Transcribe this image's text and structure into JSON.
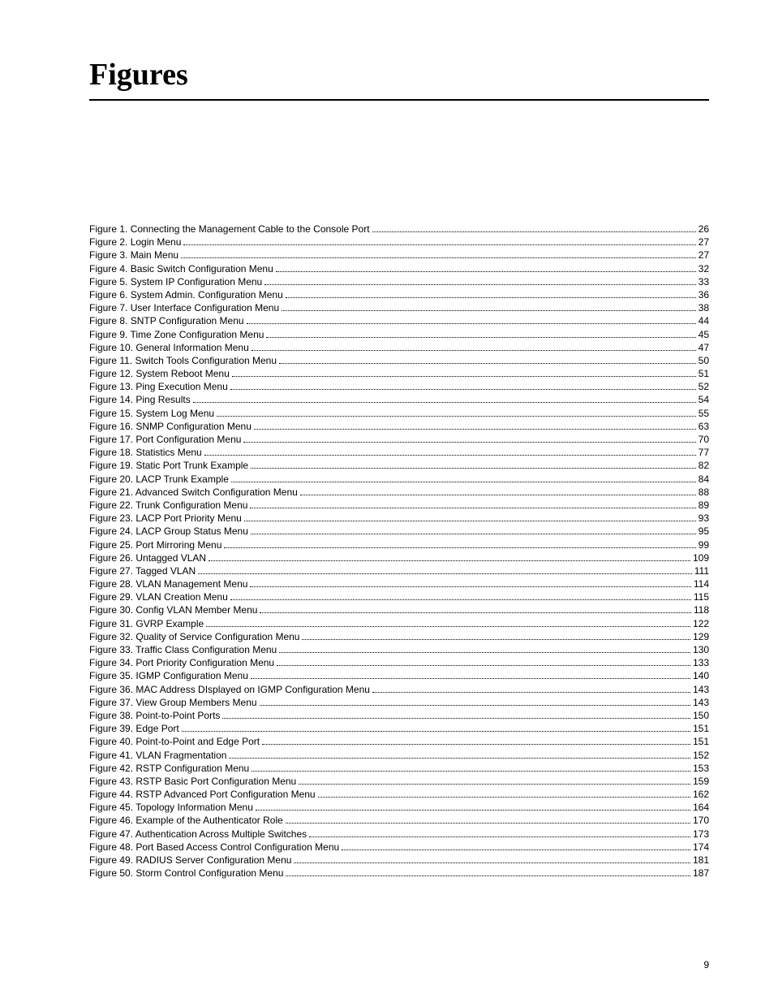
{
  "title": "Figures",
  "page_number": "9",
  "entries": [
    {
      "num": "1",
      "title": "Connecting the Management Cable to the Console Port",
      "page": "26"
    },
    {
      "num": "2",
      "title": "Login Menu",
      "page": "27"
    },
    {
      "num": "3",
      "title": "Main Menu",
      "page": "27"
    },
    {
      "num": "4",
      "title": "Basic Switch Configuration Menu",
      "page": "32"
    },
    {
      "num": "5",
      "title": "System IP Configuration Menu",
      "page": "33"
    },
    {
      "num": "6",
      "title": "System Admin. Configuration Menu",
      "page": "36"
    },
    {
      "num": "7",
      "title": "User Interface Configuration Menu",
      "page": "38"
    },
    {
      "num": "8",
      "title": "SNTP Configuration Menu",
      "page": "44"
    },
    {
      "num": "9",
      "title": "Time Zone Configuration Menu",
      "page": "45"
    },
    {
      "num": "10",
      "title": "General Information Menu",
      "page": "47"
    },
    {
      "num": "11",
      "title": "Switch Tools Configuration Menu",
      "page": "50"
    },
    {
      "num": "12",
      "title": "System Reboot Menu",
      "page": "51"
    },
    {
      "num": "13",
      "title": "Ping Execution Menu",
      "page": "52"
    },
    {
      "num": "14",
      "title": "Ping Results",
      "page": "54"
    },
    {
      "num": "15",
      "title": "System Log Menu",
      "page": "55"
    },
    {
      "num": "16",
      "title": "SNMP Configuration Menu",
      "page": "63"
    },
    {
      "num": "17",
      "title": "Port Configuration Menu",
      "page": "70"
    },
    {
      "num": "18",
      "title": "Statistics Menu",
      "page": "77"
    },
    {
      "num": "19",
      "title": "Static Port Trunk Example",
      "page": "82"
    },
    {
      "num": "20",
      "title": "LACP Trunk Example",
      "page": "84"
    },
    {
      "num": "21",
      "title": "Advanced Switch Configuration Menu",
      "page": "88"
    },
    {
      "num": "22",
      "title": "Trunk Configuration Menu",
      "page": "89"
    },
    {
      "num": "23",
      "title": "LACP Port Priority Menu",
      "page": "93"
    },
    {
      "num": "24",
      "title": "LACP Group Status Menu",
      "page": "95"
    },
    {
      "num": "25",
      "title": "Port Mirroring Menu",
      "page": "99"
    },
    {
      "num": "26",
      "title": "Untagged VLAN",
      "page": "109"
    },
    {
      "num": "27",
      "title": "Tagged VLAN",
      "page": "111"
    },
    {
      "num": "28",
      "title": "VLAN Management Menu",
      "page": "114"
    },
    {
      "num": "29",
      "title": "VLAN Creation Menu",
      "page": "115"
    },
    {
      "num": "30",
      "title": "Config VLAN Member Menu",
      "page": "118"
    },
    {
      "num": "31",
      "title": "GVRP Example",
      "page": "122"
    },
    {
      "num": "32",
      "title": "Quality of Service Configuration Menu",
      "page": "129"
    },
    {
      "num": "33",
      "title": "Traffic Class Configuration Menu",
      "page": "130"
    },
    {
      "num": "34",
      "title": "Port Priority Configuration Menu",
      "page": "133"
    },
    {
      "num": "35",
      "title": "IGMP Configuration Menu",
      "page": "140"
    },
    {
      "num": "36",
      "title": "MAC Address DIsplayed on IGMP Configuration Menu",
      "page": "143"
    },
    {
      "num": "37",
      "title": "View Group Members Menu",
      "page": "143"
    },
    {
      "num": "38",
      "title": "Point-to-Point Ports",
      "page": "150"
    },
    {
      "num": "39",
      "title": "Edge Port",
      "page": "151"
    },
    {
      "num": "40",
      "title": "Point-to-Point and Edge Port",
      "page": "151"
    },
    {
      "num": "41",
      "title": "VLAN Fragmentation",
      "page": "152"
    },
    {
      "num": "42",
      "title": "RSTP Configuration Menu",
      "page": "153"
    },
    {
      "num": "43",
      "title": "RSTP Basic Port Configuration Menu",
      "page": "159"
    },
    {
      "num": "44",
      "title": "RSTP Advanced Port Configuration Menu",
      "page": "162"
    },
    {
      "num": "45",
      "title": "Topology Information Menu",
      "page": "164"
    },
    {
      "num": "46",
      "title": "Example of the Authenticator Role",
      "page": "170"
    },
    {
      "num": "47",
      "title": "Authentication Across Multiple Switches",
      "page": "173"
    },
    {
      "num": "48",
      "title": "Port Based Access Control Configuration Menu",
      "page": "174"
    },
    {
      "num": "49",
      "title": "RADIUS Server Configuration Menu",
      "page": "181"
    },
    {
      "num": "50",
      "title": "Storm Control Configuration Menu",
      "page": "187"
    }
  ]
}
